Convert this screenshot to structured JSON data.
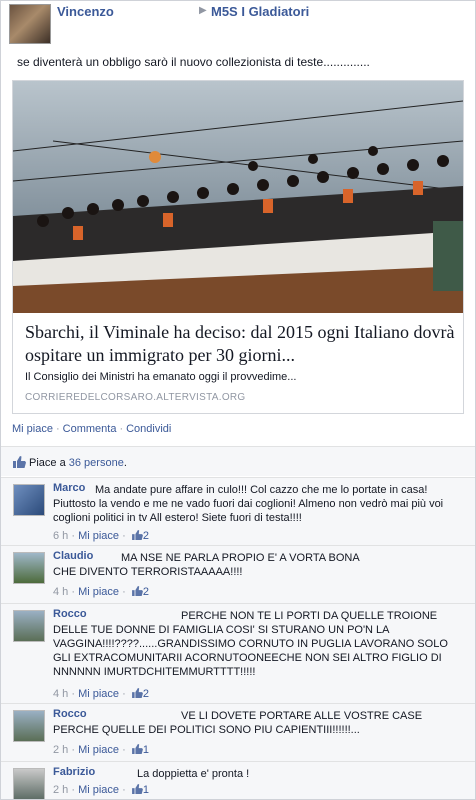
{
  "post": {
    "author": "Vincenzo",
    "group": "M5S I Gladiatori",
    "text": "se diventerà un obbligo sarò il nuovo collezionista di teste..............",
    "link": {
      "title": "Sbarchi, il Viminale ha deciso: dal 2015 ogni Italiano dovrà ospitare un immigrato per 30 giorni...",
      "description": "Il Consiglio dei Ministri ha emanato oggi il provvedime...",
      "source": "CORRIEREDELCORSARO.ALTERVISTA.ORG"
    },
    "actions": {
      "like": "Mi piace",
      "comment": "Commenta",
      "share": "Condividi"
    },
    "likes": {
      "prefix": "Piace a",
      "count": "36 persone",
      "suffix": "."
    }
  },
  "comments": [
    {
      "name": "Marco",
      "text": "Ma andate pure affare in culo!!! Col cazzo che me lo portate in casa! Piuttosto la vendo e me ne vado fuori dai coglioni! Almeno non vedrò mai più voi coglioni politici in tv All estero! Siete fuori di testa!!!!",
      "time": "6 h",
      "like": "Mi piace",
      "likes": "2"
    },
    {
      "name": "Claudio",
      "text": "MA NSE NE PARLA PROPIO E' A VORTA BONA CHE DIVENTO TERRORISTAAAAA!!!!",
      "time": "4 h",
      "like": "Mi piace",
      "likes": "2"
    },
    {
      "name": "Rocco",
      "text": "PERCHE NON TE LI PORTI DA QUELLE TROIONE DELLE TUE DONNE DI FAMIGLIA COSI' SI STURANO UN PO'N LA VAGGINA!!!!????......GRANDISSIMO CORNUTO IN PUGLIA LAVORANO SOLO GLI EXTRACOMUNITARII ACORNUTOONEECHE NON SEI ALTRO FIGLIO DI NNNNNN IMURTDCHITEMMURTTTT!!!!!",
      "time": "4 h",
      "like": "Mi piace",
      "likes": "2"
    },
    {
      "name": "Rocco",
      "text": "VE LI DOVETE PORTARE ALLE VOSTRE CASE PERCHE QUELLE DEI POLITICI SONO PIU CAPIENTIII!!!!!!...",
      "time": "2 h",
      "like": "Mi piace",
      "likes": "1"
    },
    {
      "name": "Fabrizio",
      "text": "La doppietta e' pronta !",
      "time": "2 h",
      "like": "Mi piace",
      "likes": "1"
    }
  ],
  "colors": {
    "link": "#3b5998",
    "muted": "#9197a3",
    "comment_bg": "#f6f7f9"
  }
}
